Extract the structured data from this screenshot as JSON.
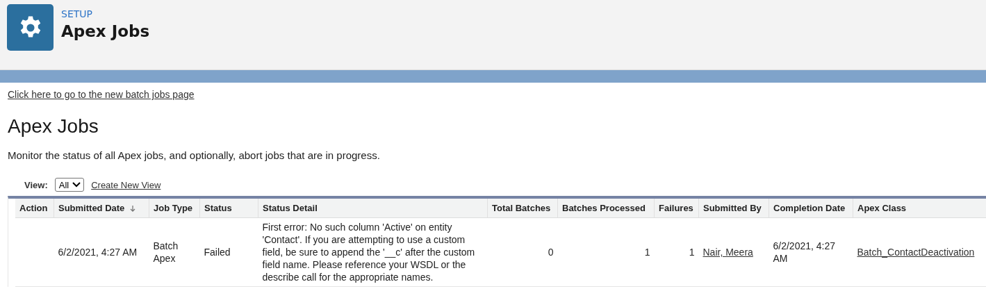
{
  "header": {
    "eyebrow": "SETUP",
    "title": "Apex Jobs"
  },
  "new_page_link": "Click here to go to the new batch jobs page",
  "page_title": "Apex Jobs",
  "description": "Monitor the status of all Apex jobs, and optionally, abort jobs that are in progress.",
  "view": {
    "label": "View:",
    "value": "All",
    "create_link": "Create New View"
  },
  "table": {
    "columns": [
      {
        "label": "Action",
        "sorted": false
      },
      {
        "label": "Submitted Date",
        "sorted": true
      },
      {
        "label": "Job Type",
        "sorted": false
      },
      {
        "label": "Status",
        "sorted": false
      },
      {
        "label": "Status Detail",
        "sorted": false
      },
      {
        "label": "Total Batches",
        "sorted": false
      },
      {
        "label": "Batches Processed",
        "sorted": false
      },
      {
        "label": "Failures",
        "sorted": false
      },
      {
        "label": "Submitted By",
        "sorted": false
      },
      {
        "label": "Completion Date",
        "sorted": false
      },
      {
        "label": "Apex Class",
        "sorted": false
      }
    ],
    "rows": [
      {
        "cells": [
          {
            "text": ""
          },
          {
            "kind": "text",
            "text": "6/2/2021, 4:27 AM"
          },
          {
            "kind": "text",
            "text": "Batch Apex"
          },
          {
            "kind": "text",
            "text": "Failed"
          },
          {
            "kind": "text",
            "text": "First error: No such column 'Active' on entity 'Contact'. If you are attempting to use a custom field, be sure to append the '__c' after the custom field name. Please reference your WSDL or the describe call for the appropriate names."
          },
          {
            "kind": "number",
            "text": "0"
          },
          {
            "kind": "number",
            "text": "1"
          },
          {
            "kind": "number",
            "text": "1"
          },
          {
            "kind": "link",
            "text": "Nair, Meera"
          },
          {
            "kind": "text",
            "text": "6/2/2021, 4:27 AM"
          },
          {
            "kind": "link",
            "text": "Batch_ContactDeactivation"
          }
        ]
      }
    ]
  }
}
